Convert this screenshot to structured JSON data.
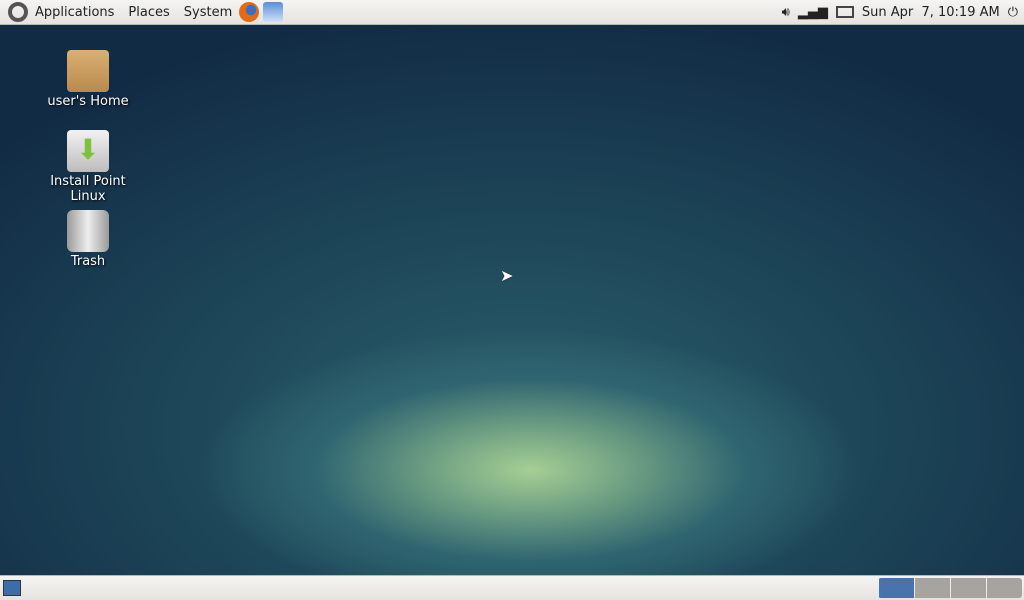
{
  "top_panel": {
    "menus": [
      "Applications",
      "Places",
      "System"
    ],
    "launchers": [
      "firefox-icon",
      "thunderbird-icon"
    ],
    "clock": "Sun Apr  7, 10:19 AM"
  },
  "desktop": {
    "icons": [
      {
        "label": "user's Home",
        "icon": "home-folder-icon"
      },
      {
        "label": "Install Point Linux",
        "icon": "install-icon"
      },
      {
        "label": "Trash",
        "icon": "trash-icon"
      }
    ]
  },
  "bottom_panel": {
    "workspaces": 4,
    "active_workspace": 1
  },
  "colors": {
    "panel": "#e9e8e4",
    "workspace_active": "#4a72ab",
    "workspace": "#a7a39e"
  }
}
